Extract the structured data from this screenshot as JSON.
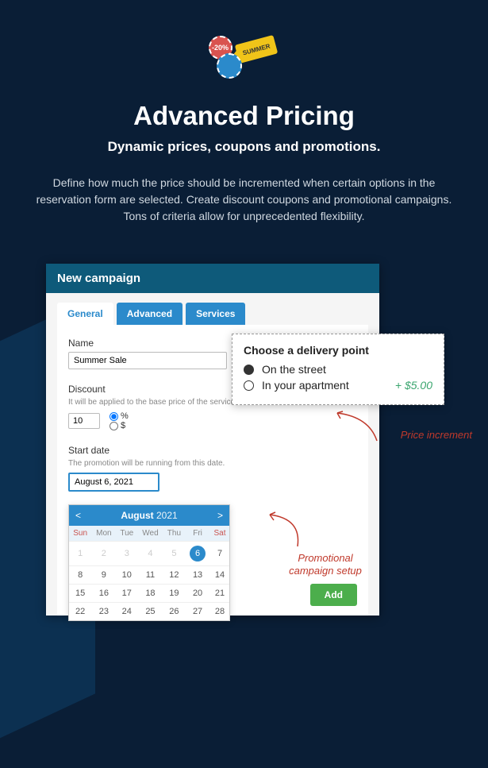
{
  "hero": {
    "badge_red": "-20%",
    "tag_text": "SUMMER",
    "title": "Advanced Pricing",
    "subtitle": "Dynamic prices, coupons and promotions.",
    "description": "Define how much the price should be incremented when certain options in the reservation form are selected. Create discount coupons and promotional campaigns. Tons of criteria allow for unprecedented flexibility."
  },
  "panel": {
    "header": "New campaign",
    "tabs": [
      "General",
      "Advanced",
      "Services"
    ],
    "name_label": "Name",
    "name_value": "Summer Sale",
    "discount_label": "Discount",
    "discount_help": "It will be applied to the base price of the service.",
    "discount_value": "10",
    "unit_percent": "%",
    "unit_currency": "$",
    "startdate_label": "Start date",
    "startdate_help": "The promotion will be running from this date.",
    "startdate_value": "August 6, 2021",
    "add_button": "Add"
  },
  "datepicker": {
    "prev": "<",
    "next": ">",
    "month": "August",
    "year": "2021",
    "dow": [
      "Sun",
      "Mon",
      "Tue",
      "Wed",
      "Thu",
      "Fri",
      "Sat"
    ],
    "rows": [
      [
        "1",
        "2",
        "3",
        "4",
        "5",
        "6",
        "7"
      ],
      [
        "8",
        "9",
        "10",
        "11",
        "12",
        "13",
        "14"
      ],
      [
        "15",
        "16",
        "17",
        "18",
        "19",
        "20",
        "21"
      ],
      [
        "22",
        "23",
        "24",
        "25",
        "26",
        "27",
        "28"
      ]
    ],
    "selected": "6"
  },
  "delivery": {
    "title": "Choose a delivery point",
    "opt1": "On the street",
    "opt2": "In your apartment",
    "increment": "+ $5.00"
  },
  "annotations": {
    "price_increment": "Price increment",
    "promo_setup": "Promotional campaign setup"
  }
}
